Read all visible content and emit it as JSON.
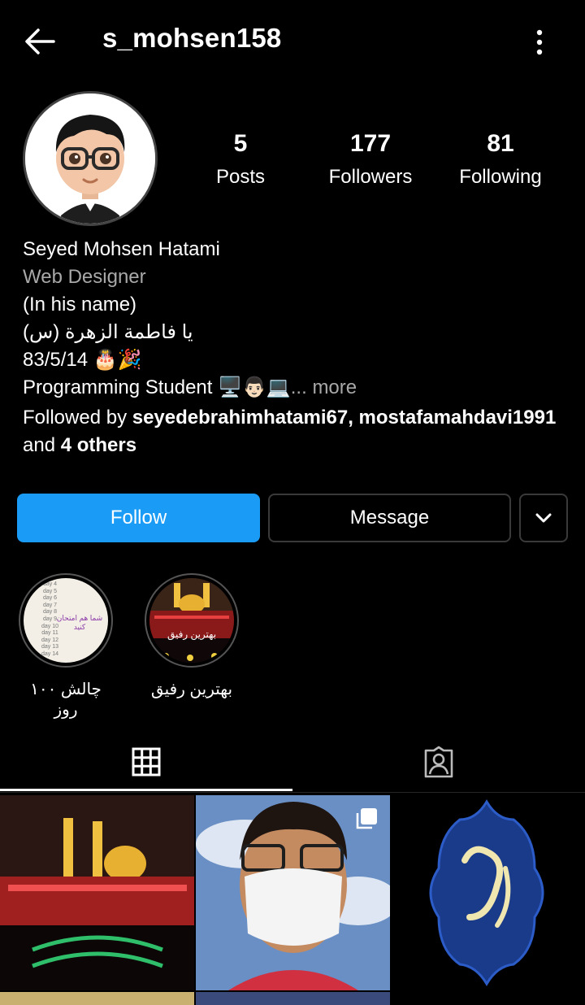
{
  "header": {
    "username": "s_mohsen158"
  },
  "stats": [
    {
      "value": "5",
      "label": "Posts"
    },
    {
      "value": "177",
      "label": "Followers"
    },
    {
      "value": "81",
      "label": "Following"
    }
  ],
  "bio": {
    "name": "Seyed Mohsen Hatami",
    "category": "Web Designer",
    "line1": "(In his name)",
    "line2": "یا فاطمة الزهرة (س)",
    "line3": "83/5/14 🎂🎉",
    "line4": "Programming Student 🖥️👨🏻💻",
    "more": "... more",
    "followed_by_prefix": "Followed by ",
    "followed_by_names": "seyedebrahimhatami67, mostafamahdavi1991",
    "followed_by_and": "and ",
    "followed_by_others": "4 others"
  },
  "buttons": {
    "follow": "Follow",
    "message": "Message"
  },
  "highlights": [
    {
      "label": "چالش ۱۰۰ روز",
      "cover_text": "شما هم امتحان کنید",
      "days": [
        "day 4",
        "day 5",
        "day 6",
        "day 7",
        "day 8",
        "day 9",
        "day 10",
        "day 11",
        "day 12",
        "day 13",
        "day 14"
      ]
    },
    {
      "label": "بهترین رفیق",
      "cover_text": "بهترین رفیق"
    }
  ],
  "colors": {
    "accent": "#1a9cf6",
    "background": "#000000",
    "muted": "#a8a8a8"
  }
}
